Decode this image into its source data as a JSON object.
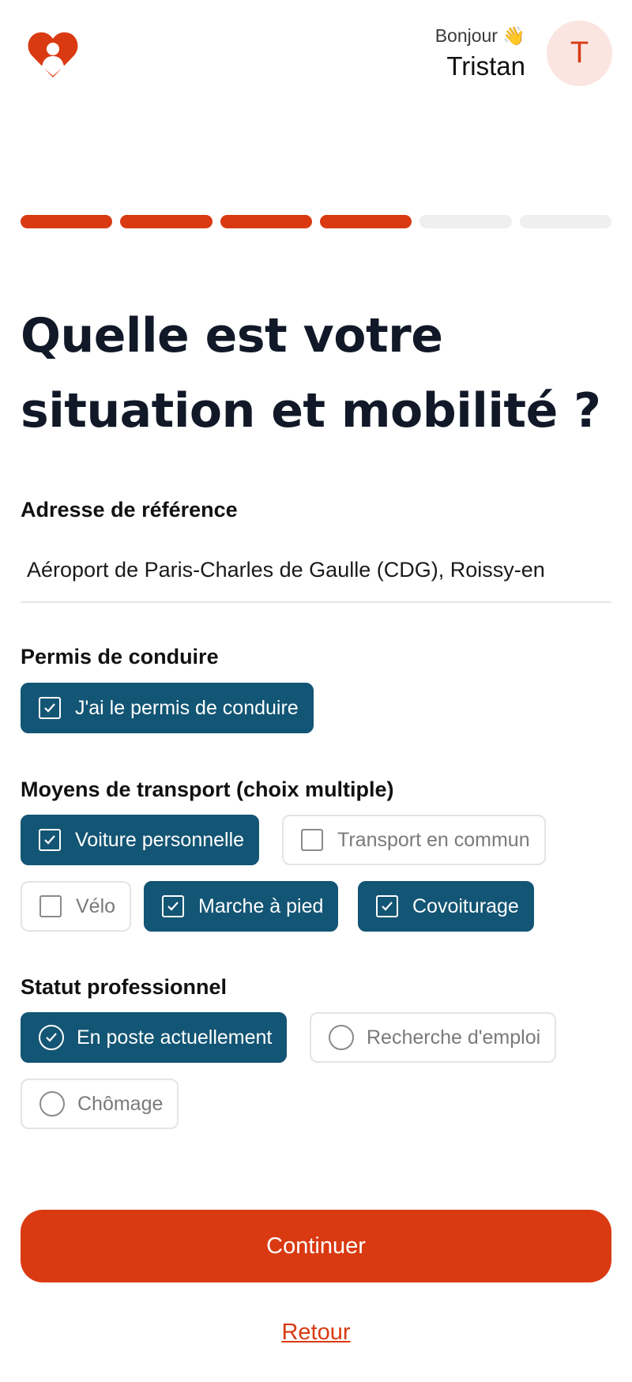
{
  "header": {
    "greeting": "Bonjour 👋",
    "user_name": "Tristan",
    "avatar_initial": "T"
  },
  "progress": {
    "steps_total": 6,
    "steps_done": 4
  },
  "title": "Quelle est votre situation et mobilité ?",
  "address": {
    "label": "Adresse de référence",
    "value": "Aéroport de Paris-Charles de Gaulle (CDG), Roissy-en"
  },
  "license": {
    "label": "Permis de conduire",
    "option": {
      "label": "J'ai le permis de conduire",
      "checked": true
    }
  },
  "transport": {
    "label": "Moyens de transport (choix multiple)",
    "options": [
      {
        "label": "Voiture personnelle",
        "checked": true
      },
      {
        "label": "Transport en commun",
        "checked": false
      },
      {
        "label": "Vélo",
        "checked": false
      },
      {
        "label": "Marche à pied",
        "checked": true
      },
      {
        "label": "Covoiturage",
        "checked": true
      }
    ]
  },
  "status": {
    "label": "Statut professionnel",
    "options": [
      {
        "label": "En poste actuellement",
        "selected": true
      },
      {
        "label": "Recherche d'emploi",
        "selected": false
      },
      {
        "label": "Chômage",
        "selected": false
      }
    ]
  },
  "actions": {
    "continue_label": "Continuer",
    "back_label": "Retour"
  },
  "colors": {
    "accent": "#d93a12",
    "selected": "#135574",
    "avatar_bg": "#fbe5e1"
  }
}
